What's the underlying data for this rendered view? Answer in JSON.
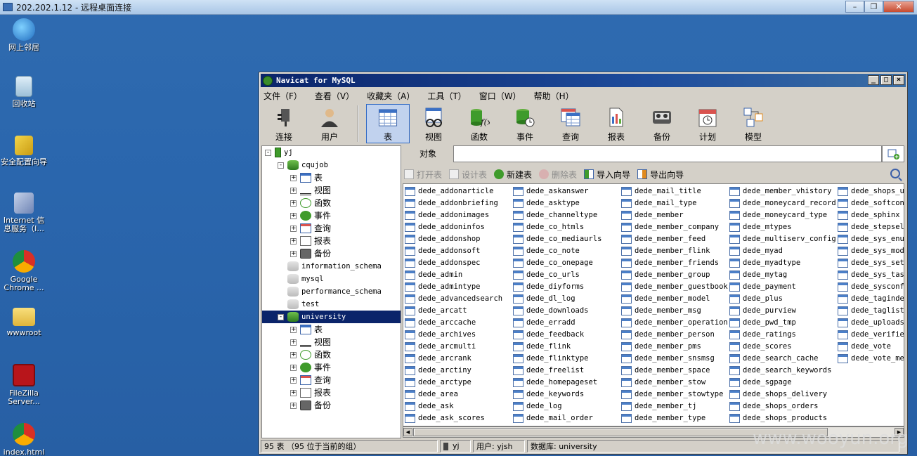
{
  "rdp": {
    "title": "202.202.1.12 - 远程桌面连接"
  },
  "desktop": {
    "icons": [
      {
        "label": "网上邻居"
      },
      {
        "label": "回收站"
      },
      {
        "label": "安全配置向导"
      },
      {
        "label": "Internet 信息服务（I..."
      },
      {
        "label": "Google Chrome ..."
      },
      {
        "label": "wwwroot"
      },
      {
        "label": "FileZilla Server..."
      },
      {
        "label": "index.html"
      }
    ]
  },
  "window": {
    "title": "Navicat for MySQL",
    "controls": [
      "_",
      "□",
      "×"
    ]
  },
  "menu": [
    "文件（F）",
    "查看（V）",
    "收藏夹（A）",
    "工具（T）",
    "窗口（W）",
    "帮助（H）"
  ],
  "toolbar": {
    "connection": [
      {
        "label": "连接",
        "icon": "plug-icon"
      },
      {
        "label": "用户",
        "icon": "user-icon"
      }
    ],
    "objects": [
      {
        "label": "表",
        "icon": "table-icon",
        "active": true
      },
      {
        "label": "视图",
        "icon": "view-icon"
      },
      {
        "label": "函数",
        "icon": "function-icon"
      },
      {
        "label": "事件",
        "icon": "event-icon"
      },
      {
        "label": "查询",
        "icon": "query-icon"
      },
      {
        "label": "报表",
        "icon": "report-icon"
      },
      {
        "label": "备份",
        "icon": "backup-icon"
      },
      {
        "label": "计划",
        "icon": "schedule-icon"
      },
      {
        "label": "模型",
        "icon": "model-icon"
      }
    ]
  },
  "tree": {
    "connection": "yj",
    "databases": [
      {
        "name": "cqujob",
        "expanded": true,
        "children": [
          "表",
          "视图",
          "函数",
          "事件",
          "查询",
          "报表",
          "备份"
        ]
      },
      {
        "name": "information_schema"
      },
      {
        "name": "mysql"
      },
      {
        "name": "performance_schema"
      },
      {
        "name": "test"
      },
      {
        "name": "university",
        "expanded": true,
        "selected": true,
        "children": [
          "表",
          "视图",
          "函数",
          "事件",
          "查询",
          "报表",
          "备份"
        ]
      }
    ]
  },
  "objects_tab": "对象",
  "object_toolbar": [
    {
      "label": "打开表",
      "enabled": false
    },
    {
      "label": "设计表",
      "enabled": false
    },
    {
      "label": "新建表",
      "enabled": true
    },
    {
      "label": "删除表",
      "enabled": false
    },
    {
      "label": "导入向导",
      "enabled": true
    },
    {
      "label": "导出向导",
      "enabled": true
    }
  ],
  "tables": [
    [
      "dede_addonarticle",
      "dede_addonbriefing",
      "dede_addonimages",
      "dede_addoninfos",
      "dede_addonshop",
      "dede_addonsoft",
      "dede_addonspec",
      "dede_admin",
      "dede_admintype",
      "dede_advancedsearch",
      "dede_arcatt",
      "dede_arccache",
      "dede_archives",
      "dede_arcmulti",
      "dede_arcrank",
      "dede_arctiny",
      "dede_arctype",
      "dede_area",
      "dede_ask",
      "dede_ask_scores"
    ],
    [
      "dede_askanswer",
      "dede_asktype",
      "dede_channeltype",
      "dede_co_htmls",
      "dede_co_mediaurls",
      "dede_co_note",
      "dede_co_onepage",
      "dede_co_urls",
      "dede_diyforms",
      "dede_dl_log",
      "dede_downloads",
      "dede_erradd",
      "dede_feedback",
      "dede_flink",
      "dede_flinktype",
      "dede_freelist",
      "dede_homepageset",
      "dede_keywords",
      "dede_log",
      "dede_mail_order"
    ],
    [
      "dede_mail_title",
      "dede_mail_type",
      "dede_member",
      "dede_member_company",
      "dede_member_feed",
      "dede_member_flink",
      "dede_member_friends",
      "dede_member_group",
      "dede_member_guestbook",
      "dede_member_model",
      "dede_member_msg",
      "dede_member_operation",
      "dede_member_person",
      "dede_member_pms",
      "dede_member_snsmsg",
      "dede_member_space",
      "dede_member_stow",
      "dede_member_stowtype",
      "dede_member_tj",
      "dede_member_type"
    ],
    [
      "dede_member_vhistory",
      "dede_moneycard_record",
      "dede_moneycard_type",
      "dede_mtypes",
      "dede_multiserv_config",
      "dede_myad",
      "dede_myadtype",
      "dede_mytag",
      "dede_payment",
      "dede_plus",
      "dede_purview",
      "dede_pwd_tmp",
      "dede_ratings",
      "dede_scores",
      "dede_search_cache",
      "dede_search_keywords",
      "dede_sgpage",
      "dede_shops_delivery",
      "dede_shops_orders",
      "dede_shops_products"
    ],
    [
      "dede_shops_use",
      "dede_softconfi",
      "dede_sphinx",
      "dede_stepselec",
      "dede_sys_enum",
      "dede_sys_modul",
      "dede_sys_set",
      "dede_sys_task",
      "dede_sysconfig",
      "dede_tagindex",
      "dede_taglist",
      "dede_uploads",
      "dede_verifies",
      "dede_vote",
      "dede_vote_memb"
    ]
  ],
  "status": {
    "count": "95 表 （95 位于当前的组）",
    "connection": "yj",
    "user": "用户: yjsh",
    "database": "数据库: university"
  },
  "watermark": "www.wooyun.org"
}
